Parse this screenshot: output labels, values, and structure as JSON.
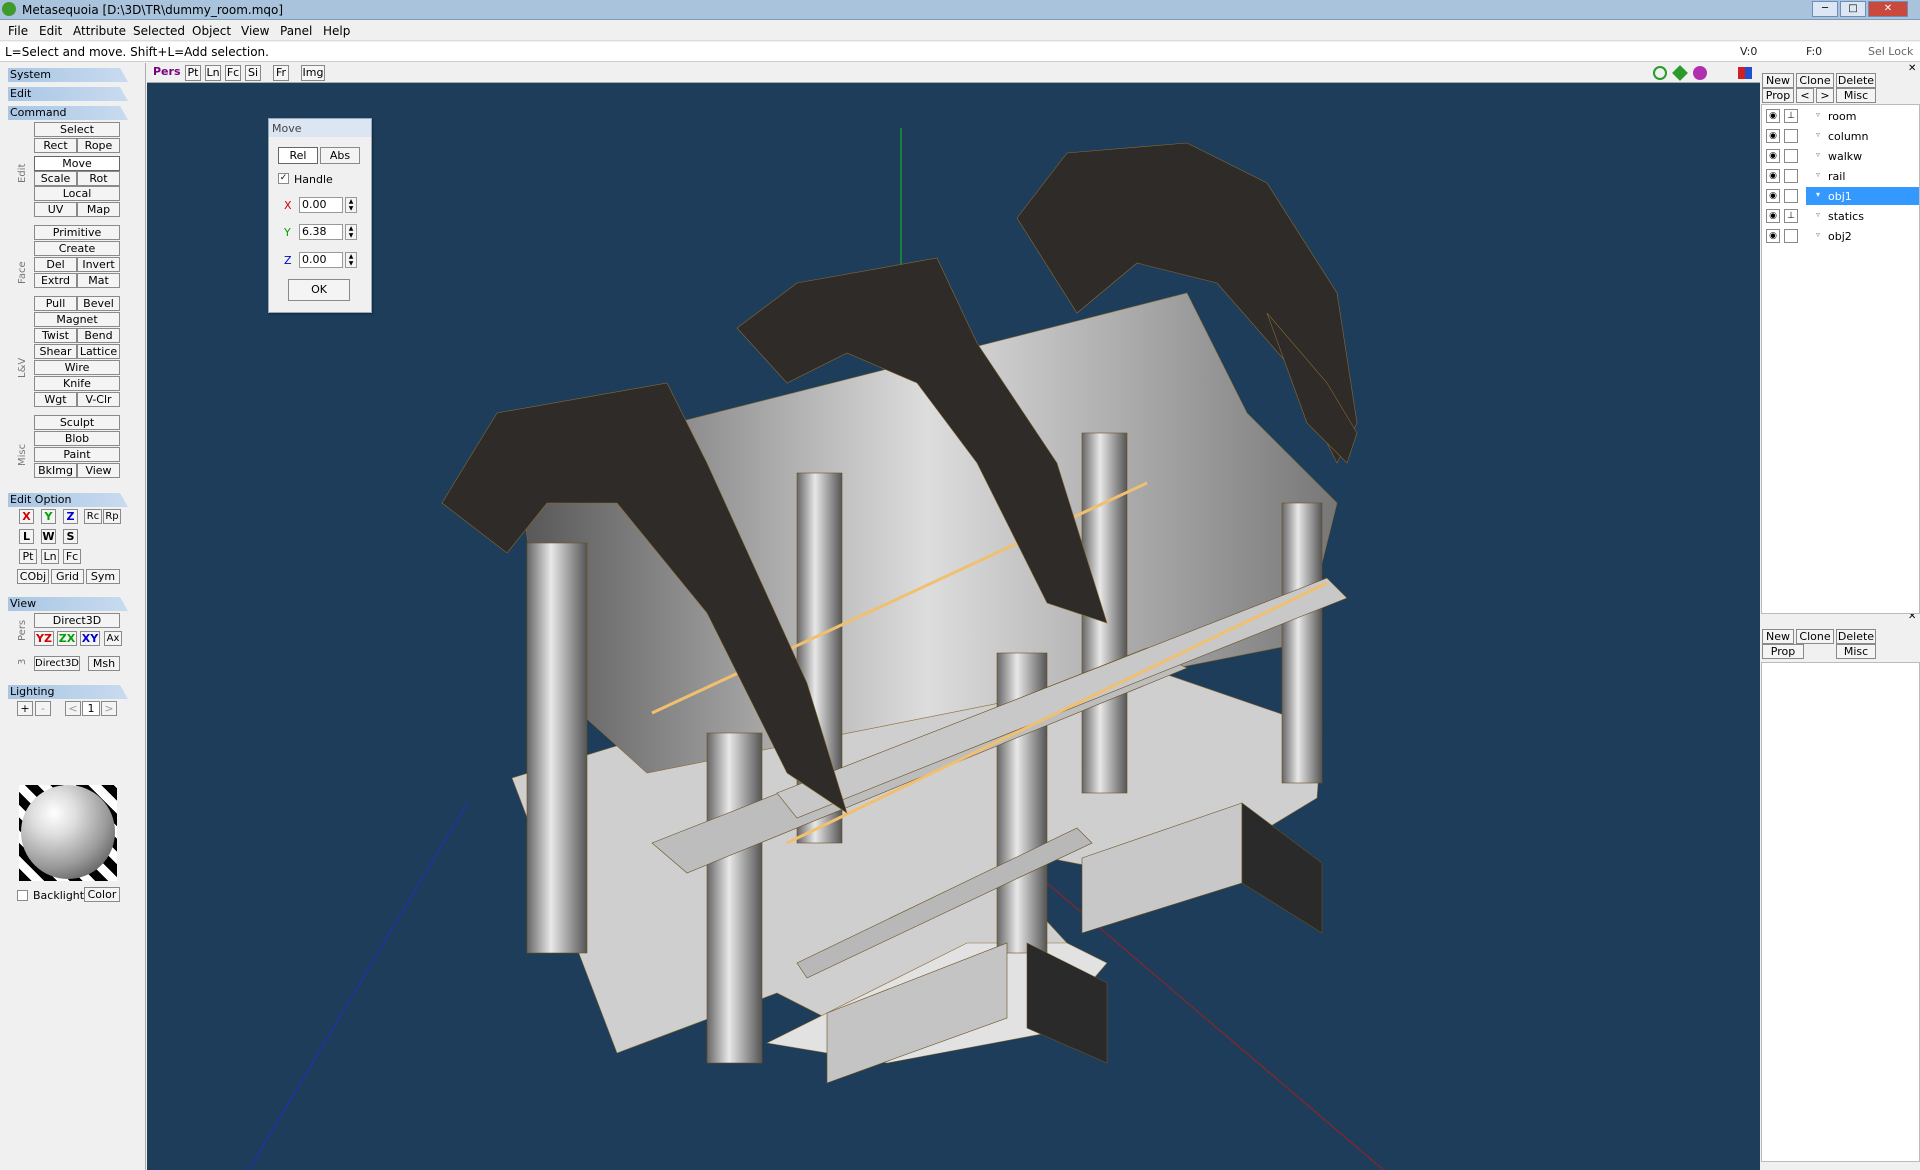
{
  "window": {
    "title": "Metasequoia [D:\\3D\\TR\\dummy_room.mqo]",
    "min": "─",
    "max": "□",
    "close": "✕"
  },
  "menu": [
    "File",
    "Edit",
    "Attribute",
    "Selected",
    "Object",
    "View",
    "Panel",
    "Help"
  ],
  "status": {
    "hint": "L=Select and move.  Shift+L=Add selection.",
    "v": "V:0",
    "f": "F:0",
    "sellock": "Sel Lock"
  },
  "left": {
    "system": "System",
    "edit": "Edit",
    "command": "Command",
    "group_edit": "Edit",
    "group_face": "Face",
    "group_lv": "L&V",
    "group_misc": "Misc",
    "select": "Select",
    "rect": "Rect",
    "rope": "Rope",
    "move": "Move",
    "scale": "Scale",
    "rot": "Rot",
    "local": "Local",
    "uv": "UV",
    "map": "Map",
    "primitive": "Primitive",
    "create": "Create",
    "del": "Del",
    "invert": "Invert",
    "extrd": "Extrd",
    "mat": "Mat",
    "pull": "Pull",
    "bevel": "Bevel",
    "magnet": "Magnet",
    "twist": "Twist",
    "bend": "Bend",
    "shear": "Shear",
    "lattice": "Lattice",
    "wire": "Wire",
    "knife": "Knife",
    "wgt": "Wgt",
    "vclr": "V-Clr",
    "sculpt": "Sculpt",
    "blob": "Blob",
    "paint": "Paint",
    "bkimg": "BkImg",
    "view": "View",
    "edit_option": "Edit Option",
    "x": "X",
    "y": "Y",
    "z": "Z",
    "rc": "Rc",
    "rp": "Rp",
    "l": "L",
    "w": "W",
    "s": "S",
    "pt": "Pt",
    "ln": "Ln",
    "fc": "Fc",
    "cobj": "CObj",
    "grid": "Grid",
    "sym": "Sym",
    "view_section": "View",
    "pers": "Pers",
    "direct3d": "Direct3D",
    "yz": "YZ",
    "zx": "ZX",
    "xy": "XY",
    "ax": "Ax",
    "three": "3",
    "direct3d_2": "Direct3D",
    "msh": "Msh",
    "lighting": "Lighting",
    "plus": "+",
    "minus": "-",
    "prev": "<",
    "light_num": "1",
    "next": ">",
    "backlight": "Backlight",
    "color": "Color"
  },
  "viewtabs": {
    "pers": "Pers",
    "pt": "Pt",
    "ln": "Ln",
    "fc": "Fc",
    "si": "Si",
    "fr": "Fr",
    "img": "Img"
  },
  "move_dialog": {
    "title": "Move",
    "rel": "Rel",
    "abs": "Abs",
    "handle": "Handle",
    "x_label": "X",
    "y_label": "Y",
    "z_label": "Z",
    "x": "0.00",
    "y": "6.38",
    "z": "0.00",
    "ok": "OK"
  },
  "right": {
    "new": "New",
    "clone": "Clone",
    "delete": "Delete",
    "prop": "Prop",
    "lt": "<",
    "gt": ">",
    "misc": "Misc",
    "objects": [
      "room",
      "column",
      "walkw",
      "rail",
      "obj1",
      "statics",
      "obj2"
    ],
    "selected": "obj1",
    "new2": "New",
    "clone2": "Clone",
    "delete2": "Delete",
    "prop2": "Prop",
    "misc2": "Misc"
  },
  "colors": {
    "viewport_bg": "#1d3d5a",
    "selection": "#3399ff",
    "axis_x": "#d02020",
    "axis_y": "#20b020",
    "axis_z": "#2030c0"
  }
}
